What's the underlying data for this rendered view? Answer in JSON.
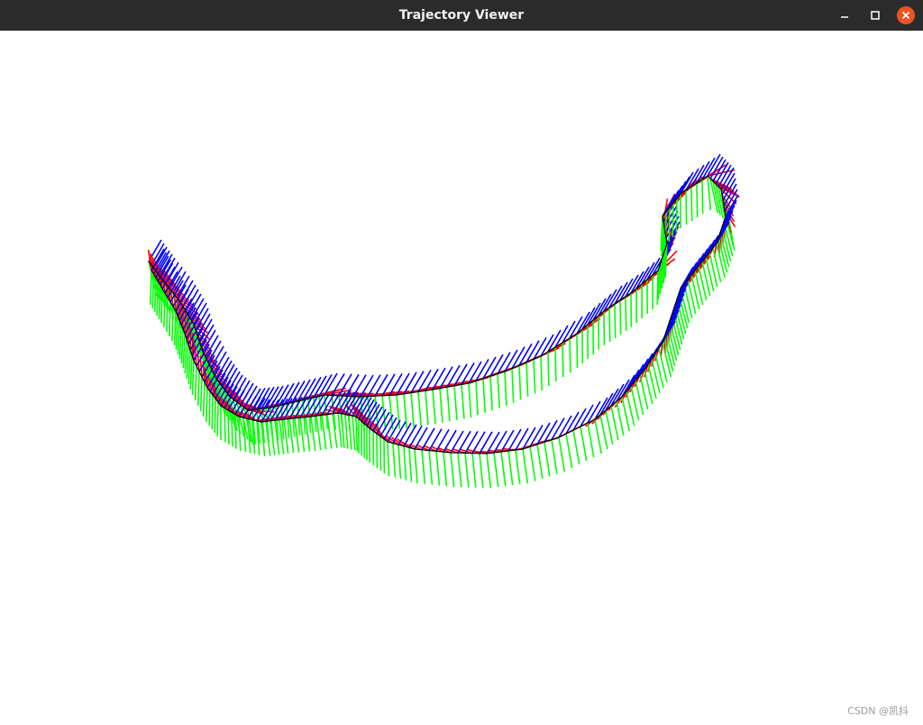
{
  "window": {
    "title": "Trajectory Viewer"
  },
  "controls": {
    "minimize_icon": "minimize-icon",
    "maximize_icon": "maximize-icon",
    "close_icon": "close-icon",
    "close_color": "#e95420"
  },
  "viewer": {
    "background": "#ffffff",
    "path_color": "#000000",
    "axis_colors": {
      "x": "#ff0000",
      "y": "#00ff00",
      "z": "#0000ff"
    }
  },
  "watermark": "CSDN @凯抖"
}
